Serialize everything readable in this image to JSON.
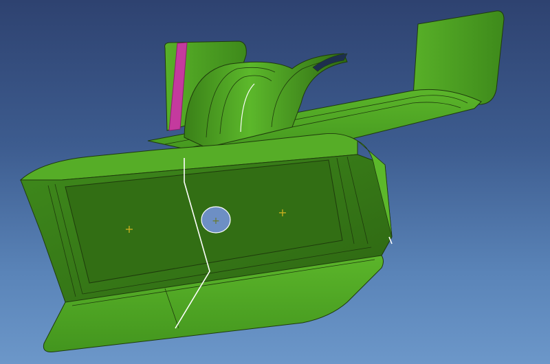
{
  "viewport": {
    "background_top": "#2e4270",
    "background_bottom": "#6c97c9"
  },
  "part": {
    "surface_color": "#4a9e22",
    "surface_shadow_color": "#2f6a13",
    "edge_color": "#1e3a0c",
    "highlight_color": "#ffffff",
    "selected_face_color": "#c43a9e",
    "hole_color": "#6d8fc4",
    "marker_color": "#c8b020",
    "marker_glyph": "+"
  }
}
